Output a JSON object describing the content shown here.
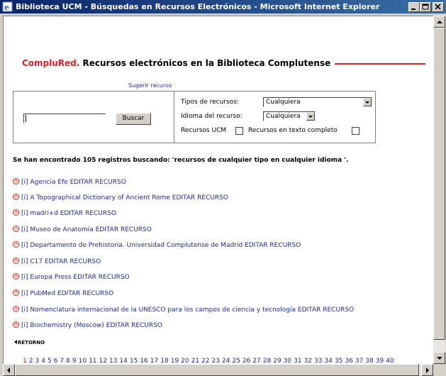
{
  "window": {
    "title": "Biblioteca UCM - Búsquedas en Recursos Electrónicos - Microsoft Internet Explorer"
  },
  "header": {
    "brand": "CompluRed.",
    "title": " Recursos electrónicos en la Biblioteca Complutense"
  },
  "suggest_link": "Sugerir recurso",
  "search": {
    "query": "",
    "button": "Buscar"
  },
  "filters": {
    "type_label": "Tipos de recursos:",
    "type_value": "Cualquiera",
    "lang_label": "Idioma del recurso:",
    "lang_value": "Cualquiera",
    "ucm_label": "Recursos UCM",
    "fulltext_label": "Recursos en texto completo"
  },
  "summary": "Se han encontrado 105 registros buscando: 'recursos de cualquier tipo en cualquier idioma '.",
  "results": [
    "[i] Agencia Efe EDITAR RECURSO",
    "[i] A Topographical Dictionary of Ancient Rome EDITAR RECURSO",
    "[i] madri+d EDITAR RECURSO",
    "[i] Museo de Anatomía EDITAR RECURSO",
    "[i] Departamento de Prehistoria. Universidad Complutense de Madrid EDITAR RECURSO",
    "[i] C17 EDITAR RECURSO",
    "[i] Europa Press EDITAR RECURSO",
    "[i] PubMed EDITAR RECURSO",
    "[i] Nomenclatura internacional de la UNESCO para los campos de ciencia y tecnología EDITAR RECURSO",
    "[i] Biochemistry (Moscow) EDITAR RECURSO"
  ],
  "retorno": "RETORNO",
  "pages": [
    "1",
    "2",
    "3",
    "4",
    "5",
    "6",
    "7",
    "8",
    "9",
    "10",
    "11",
    "12",
    "13",
    "14",
    "15",
    "16",
    "17",
    "18",
    "19",
    "20",
    "21",
    "22",
    "23",
    "24",
    "25",
    "26",
    "27",
    "28",
    "29",
    "30",
    "31",
    "32",
    "33",
    "34",
    "35",
    "36",
    "37",
    "38",
    "39",
    "40"
  ],
  "current_page": "1",
  "colors": {
    "brand": "#d9232d",
    "link": "#1f2a8c",
    "titlebar": "#0a246a"
  }
}
